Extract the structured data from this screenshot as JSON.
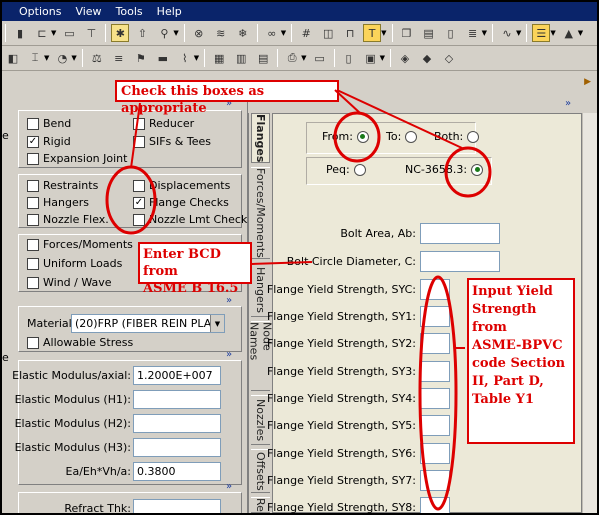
{
  "menu": [
    "Options",
    "View",
    "Tools",
    "Help"
  ],
  "left_edge_letters": [
    "e",
    "e"
  ],
  "elements_group": {
    "items": [
      {
        "label": "Bend",
        "checked": false
      },
      {
        "label": "Reducer",
        "checked": false
      },
      {
        "label": "Rigid",
        "checked": true
      },
      {
        "label": "SIFs & Tees",
        "checked": false
      },
      {
        "label": "Expansion Joint",
        "checked": false
      }
    ]
  },
  "aux_group": {
    "items": [
      {
        "label": "Restraints",
        "checked": false
      },
      {
        "label": "Displacements",
        "checked": false
      },
      {
        "label": "Hangers",
        "checked": false
      },
      {
        "label": "Flange Checks",
        "checked": true
      },
      {
        "label": "Nozzle Flex.",
        "checked": false
      },
      {
        "label": "Nozzle Lmt Check",
        "checked": false
      }
    ]
  },
  "loads_group": {
    "items": [
      {
        "label": "Forces/Moments",
        "checked": false
      },
      {
        "label": "Uniform Loads",
        "checked": false
      },
      {
        "label": "Wind / Wave",
        "checked": false
      }
    ]
  },
  "material": {
    "label": "Material:",
    "value": "(20)FRP (FIBER REIN PLA",
    "allowable_stress_label": "Allowable Stress"
  },
  "elastic": {
    "rows": [
      {
        "label": "Elastic Modulus/axial:",
        "value": "1.2000E+007"
      },
      {
        "label": "Elastic Modulus (H1):",
        "value": ""
      },
      {
        "label": "Elastic Modulus (H2):",
        "value": ""
      },
      {
        "label": "Elastic Modulus (H3):",
        "value": ""
      },
      {
        "label": "Ea/Eh*Vh/a:",
        "value": "0.3800"
      }
    ]
  },
  "refract": {
    "label": "Refract Thk:"
  },
  "chevron": "»",
  "tabs": [
    "Flanges",
    "Forces/Moments",
    "Hangers",
    "Node Names",
    "Nozzles",
    "Offsets",
    "Re"
  ],
  "flanges": {
    "from_label": "From:",
    "to_label": "To:",
    "both_label": "Both:",
    "peq_label": "Peq:",
    "nc_label": "NC-3658.3:",
    "selected_method": "From",
    "selected_type": "NC-3658.3",
    "fields": [
      "Bolt Area, Ab:",
      "Bolt Circle Diameter, C:",
      "Flange Yield Strength, SYC:",
      "Flange Yield Strength, SY1:",
      "Flange Yield Strength, SY2:",
      "Flange Yield Strength, SY3:",
      "Flange Yield Strength, SY4:",
      "Flange Yield Strength, SY5:",
      "Flange Yield Strength, SY6:",
      "Flange Yield Strength, SY7:",
      "Flange Yield Strength, SY8:"
    ]
  },
  "annotations": {
    "check_boxes": "Check this boxes as appropriate",
    "bcd_line1": "Enter BCD from",
    "bcd_line2": "ASME B 16.5",
    "yield_lines": [
      "Input Yield",
      "Strength from",
      "ASME-BPVC",
      "code Section",
      "II, Part D,",
      "Table Y1"
    ],
    "color": "#dd0000"
  }
}
